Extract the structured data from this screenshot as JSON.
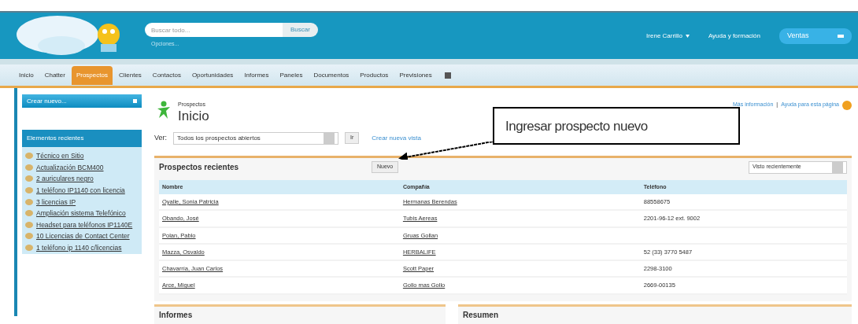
{
  "header": {
    "search": {
      "placeholder": "Buscar todo..."
    },
    "search_button": "Buscar",
    "options_link": "Opciones...",
    "user_menu": "Irene Carrillo",
    "help_link": "Ayuda y formación",
    "app_menu": "Ventas"
  },
  "tabs": [
    {
      "label": "Inicio",
      "selected": false
    },
    {
      "label": "Chatter",
      "selected": false
    },
    {
      "label": "Prospectos",
      "selected": true
    },
    {
      "label": "Clientes",
      "selected": false
    },
    {
      "label": "Contactos",
      "selected": false
    },
    {
      "label": "Oportunidades",
      "selected": false
    },
    {
      "label": "Informes",
      "selected": false
    },
    {
      "label": "Paneles",
      "selected": false
    },
    {
      "label": "Documentos",
      "selected": false
    },
    {
      "label": "Productos",
      "selected": false
    },
    {
      "label": "Previsiones",
      "selected": false
    }
  ],
  "sidebar": {
    "create_button": "Crear nuevo...",
    "recent_title": "Elementos recientes",
    "items": [
      "Técnico en Sitio",
      "Actualización BCM400",
      "2 auriculares negro",
      "1 teléfono IP1140 con licencia",
      "3 licencias IP",
      "Ampliación sistema Telefónico",
      "Headset para teléfonos IP1140E",
      "10 Licencias de Contact Center",
      "1 teléfono ip 1140 c/licencias"
    ]
  },
  "page": {
    "object": "Prospectos",
    "title": "Inicio",
    "help_links": [
      "Más información",
      "Ayuda para esta página"
    ],
    "help_separator": "|",
    "view_label": "Ver:",
    "view_select": "Todos los prospectos abiertos",
    "go_button": "Ir",
    "create_view_link": "Crear nueva vista"
  },
  "recent": {
    "title": "Prospectos recientes",
    "new_button": "Nuevo",
    "sort_select": "Visto recientemente",
    "columns": [
      "Nombre",
      "Compañía",
      "Teléfono"
    ],
    "rows": [
      [
        "Oyalle, Sonia Patricia",
        "Hermanas Berendas",
        "88558675"
      ],
      [
        "Obando, José",
        "Tubis Aereas",
        "2201-96-12 ext. 9002"
      ],
      [
        "Polan, Pablo",
        "Gruas Gollan",
        ""
      ],
      [
        "Mazza, Osvaldo",
        "HERBALIFE",
        "52 (33) 3770 5487"
      ],
      [
        "Chavarría, Juan Carlos",
        "Scott Paper",
        "2298-3100"
      ],
      [
        "Arce, Miguel",
        "Gollo mas Gollo",
        "2669-00135"
      ]
    ]
  },
  "bottom_panels": [
    "Informes",
    "Resumen"
  ],
  "callout": "Ingresar prospecto  nuevo"
}
